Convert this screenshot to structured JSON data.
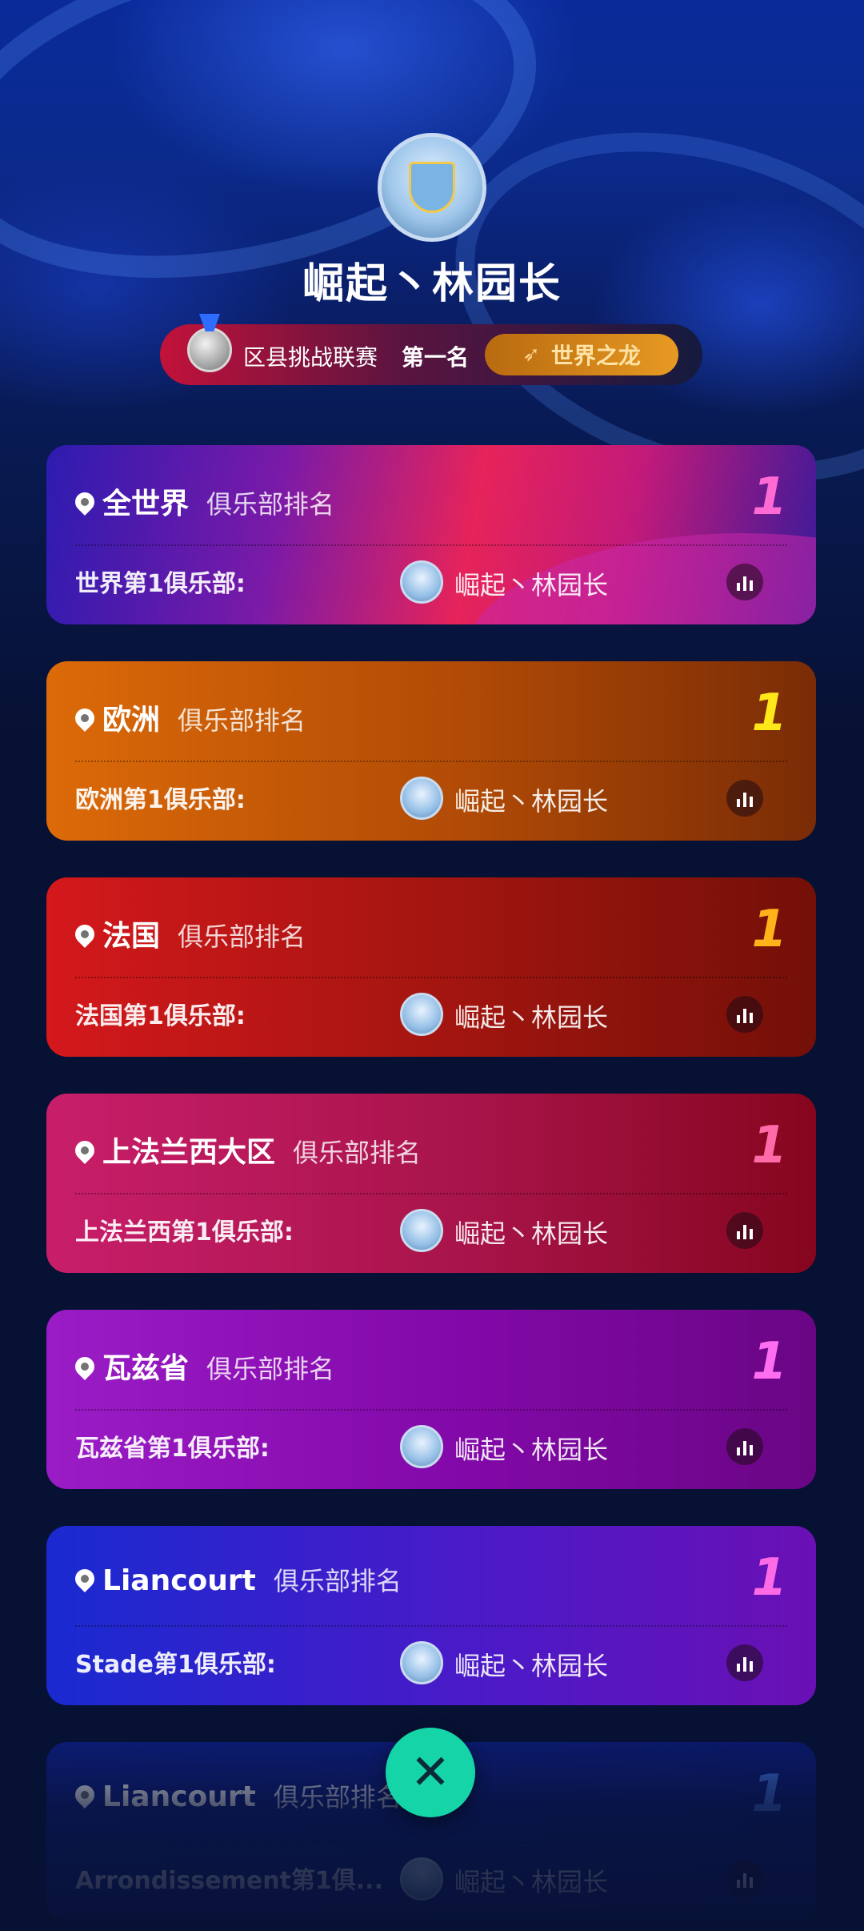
{
  "header": {
    "team_name": "崛起丶林园长",
    "league_name": "区县挑战联赛",
    "league_rank": "第一名",
    "honor_title": "世界之龙"
  },
  "cards": [
    {
      "region": "全世界",
      "rank_label": "俱乐部排名",
      "rank": "1",
      "rank_color": "#ff6ad5",
      "row_label": "世界第1俱乐部:",
      "club_name": "崛起丶林园长"
    },
    {
      "region": "欧洲",
      "rank_label": "俱乐部排名",
      "rank": "1",
      "rank_color": "#ffe81a",
      "row_label": "欧洲第1俱乐部:",
      "club_name": "崛起丶林园长"
    },
    {
      "region": "法国",
      "rank_label": "俱乐部排名",
      "rank": "1",
      "rank_color": "#ffb21a",
      "row_label": "法国第1俱乐部:",
      "club_name": "崛起丶林园长"
    },
    {
      "region": "上法兰西大区",
      "rank_label": "俱乐部排名",
      "rank": "1",
      "rank_color": "#ff6aa8",
      "row_label": "上法兰西第1俱乐部:",
      "club_name": "崛起丶林园长"
    },
    {
      "region": "瓦兹省",
      "rank_label": "俱乐部排名",
      "rank": "1",
      "rank_color": "#ff6ef0",
      "row_label": "瓦兹省第1俱乐部:",
      "club_name": "崛起丶林园长"
    },
    {
      "region": "Liancourt",
      "rank_label": "俱乐部排名",
      "rank": "1",
      "rank_color": "#ff6ae6",
      "row_label": "Stade第1俱乐部:",
      "club_name": "崛起丶林园长"
    },
    {
      "region": "Liancourt",
      "rank_label": "俱乐部排名",
      "rank": "1",
      "rank_color": "#3a6ad0",
      "row_label": "Arrondissement第1俱...",
      "club_name": "崛起丶林园长"
    }
  ],
  "close_button": {
    "icon": "close-icon",
    "color": "#14d4a8"
  }
}
